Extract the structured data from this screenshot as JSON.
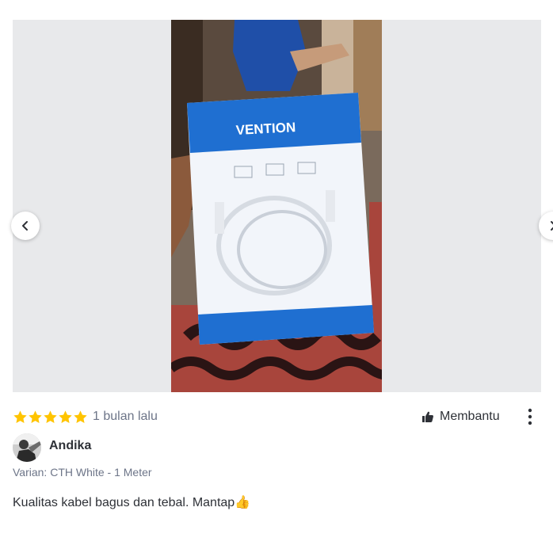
{
  "review": {
    "rating": 5,
    "rating_max": 5,
    "time_ago": "1 bulan lalu",
    "helpful_label": "Membantu",
    "reviewer_name": "Andika",
    "variant": "Varian: CTH White - 1 Meter",
    "text": "Kualitas kabel bagus dan tebal. Mantap👍"
  },
  "photo": {
    "package_brand": "VENTION"
  },
  "colors": {
    "star": "#ffc400",
    "text_primary": "#2e3137",
    "text_secondary": "#6d7588",
    "gallery_bg": "#e8e9eb"
  },
  "icons": {
    "prev": "chevron-left-icon",
    "next": "chevron-right-icon",
    "helpful": "thumbs-up-icon",
    "more": "more-vertical-icon"
  }
}
